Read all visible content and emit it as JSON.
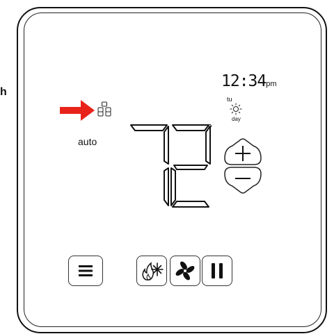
{
  "edge_text": "h",
  "mode": {
    "label": "auto",
    "icon": "schedule-icon"
  },
  "pointer": {
    "icon": "red-arrow-icon",
    "color": "#e8241a"
  },
  "clock": {
    "time": "12:34",
    "ampm": "pm"
  },
  "schedule_period": {
    "line1": "tu",
    "line2": "day",
    "icon": "sun-icon"
  },
  "temperature": {
    "value": "72",
    "unit_symbol": "°"
  },
  "controls": {
    "increase_icon": "plus-icon",
    "decrease_icon": "minus-icon",
    "menu_icon": "hamburger-menu-icon",
    "system_mode_icon": "heat-cool-icon",
    "fan_icon": "fan-icon",
    "hold_icon": "pause-icon"
  }
}
